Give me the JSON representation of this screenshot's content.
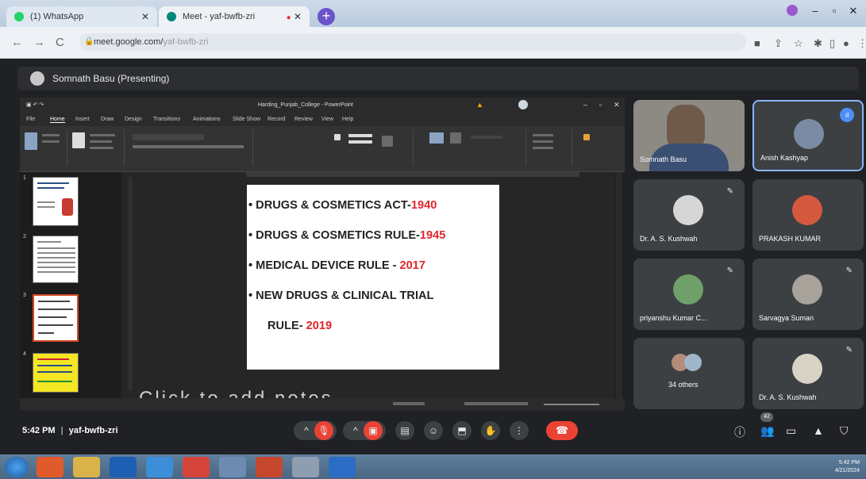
{
  "browser": {
    "tabs": [
      {
        "label": "(1) WhatsApp",
        "active": false
      },
      {
        "label": "Meet - yaf-bwfb-zri",
        "active": true
      }
    ],
    "url_host": "meet.google.com/",
    "url_path": "yaf-bwfb-zri"
  },
  "meet": {
    "presenter_label": "Somnath Basu (Presenting)",
    "meeting_time": "5:42 PM",
    "meeting_code": "yaf-bwfb-zri",
    "participant_count": "42",
    "participants": [
      {
        "name": "Somnath Basu",
        "video": true
      },
      {
        "name": "Anish Kashyap",
        "speaking": true
      },
      {
        "name": "Dr. A. S. Kushwah",
        "muted": true
      },
      {
        "name": "PRAKASH KUMAR",
        "muted": false
      },
      {
        "name": "priyanshu Kumar C...",
        "muted": true
      },
      {
        "name": "Sarvagya Suman",
        "muted": true
      },
      {
        "name": "34 others"
      },
      {
        "name": "Dr. A. S. Kushwah",
        "muted": true
      }
    ]
  },
  "powerpoint": {
    "title": "Harding_Punjab_College - PowerPoint",
    "menu": [
      "File",
      "Home",
      "Insert",
      "Draw",
      "Design",
      "Transitions",
      "Animations",
      "Slide Show",
      "Record",
      "Review",
      "View",
      "Help"
    ],
    "notes_placeholder": "Click to add notes",
    "slide": {
      "bullets": [
        {
          "text": "• DRUGS & COSMETICS ACT-",
          "year": "1940"
        },
        {
          "text": "• DRUGS & COSMETICS RULE-",
          "year": "1945"
        },
        {
          "text": "• MEDICAL DEVICE RULE - ",
          "year": "2017"
        },
        {
          "text": "• NEW DRUGS & CLINICAL TRIAL",
          "year": ""
        },
        {
          "text": "RULE- ",
          "year": "2019"
        }
      ]
    },
    "thumbnail_numbers": [
      "1",
      "2",
      "3",
      "4"
    ]
  },
  "taskbar": {
    "time": "5:42 PM",
    "date": "4/21/2024"
  },
  "colors": {
    "accent_red": "#e0262b",
    "meet_bg": "#202124",
    "end_call": "#ea4335"
  }
}
